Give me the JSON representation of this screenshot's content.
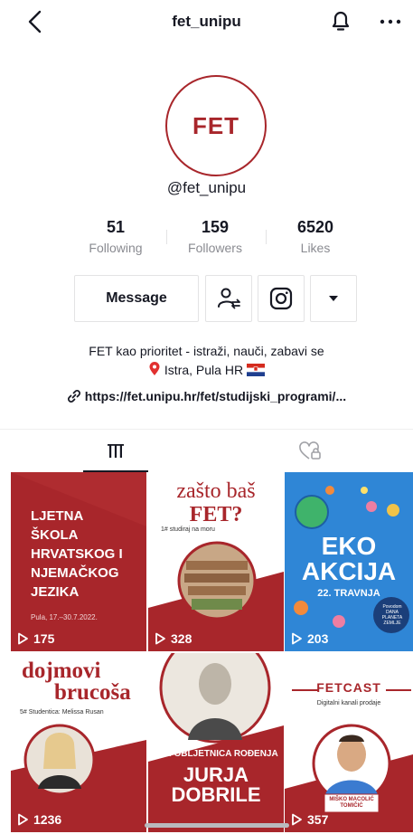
{
  "header": {
    "title": "fet_unipu"
  },
  "profile": {
    "avatar_text": "FET",
    "username": "@fet_unipu",
    "stats": [
      {
        "value": "51",
        "label": "Following"
      },
      {
        "value": "159",
        "label": "Followers"
      },
      {
        "value": "6520",
        "label": "Likes"
      }
    ],
    "message_label": "Message",
    "bio_line1": "FET kao prioritet - istraži, nauči, zabavi se",
    "bio_line2": "Istra, Pula HR",
    "link": "https://fet.unipu.hr/fet/studijski_programi/..."
  },
  "videos": [
    {
      "views": "175",
      "lines": [
        "LJETNA",
        "ŠKOLA",
        "HRVATSKOG I",
        "NJEMAČKOG",
        "JEZIKA"
      ],
      "sub": "Pula, 17.–30.7.2022."
    },
    {
      "views": "328",
      "title1": "zašto baš",
      "title2": "FET?",
      "sub": "1# studiraj na moru"
    },
    {
      "views": "203",
      "title1": "EKO",
      "title2": "AKCIJA",
      "sub": "22. TRAVNJA",
      "badge": "Povodom DANA PLANETA ZEMLJE"
    },
    {
      "views": "1236",
      "title1": "dojmovi",
      "title2": "brucoša",
      "sub": "5# Studentica: Melissa Rusan"
    },
    {
      "views": "",
      "sub": "210. OBLJETNICA ROĐENJA",
      "title1": "JURJA",
      "title2": "DOBRILE"
    },
    {
      "views": "357",
      "title1": "FETCAST",
      "sub": "Digitalni kanali prodaje",
      "name": "MIŠKO MACOLIĆ TOMIČIĆ"
    }
  ],
  "colors": {
    "brand_red": "#a8262b",
    "eko_blue": "#2f86d6"
  }
}
